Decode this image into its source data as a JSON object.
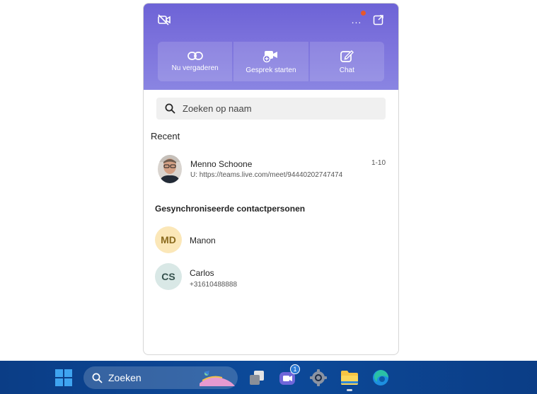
{
  "header": {
    "actions": [
      {
        "label": "Nu vergaderen",
        "icon": "link-icon"
      },
      {
        "label": "Gesprek starten",
        "icon": "video-add-icon"
      },
      {
        "label": "Chat",
        "icon": "compose-icon"
      }
    ],
    "more_label": "..."
  },
  "search": {
    "placeholder": "Zoeken op naam"
  },
  "recent": {
    "title": "Recent",
    "items": [
      {
        "name": "Menno Schoone",
        "subtitle": "U: https://teams.live.com/meet/94440202747474",
        "date": "1-10"
      }
    ]
  },
  "synced": {
    "title": "Gesynchroniseerde contactpersonen",
    "contacts": [
      {
        "initials": "MD",
        "name": "Manon",
        "detail": "",
        "bg": "#fbe7b8",
        "fg": "#8a6a1d"
      },
      {
        "initials": "CS",
        "name": "Carlos",
        "detail": "+31610488888",
        "bg": "#d9e8e6",
        "fg": "#35514d"
      }
    ]
  },
  "taskbar": {
    "search_label": "Zoeken",
    "teams_badge": "1"
  },
  "colors": {
    "header_gradient_top": "#6d63d6",
    "header_gradient_bottom": "#8a85e2",
    "taskbar": "#0c4a9a",
    "notify": "#e8572a"
  }
}
